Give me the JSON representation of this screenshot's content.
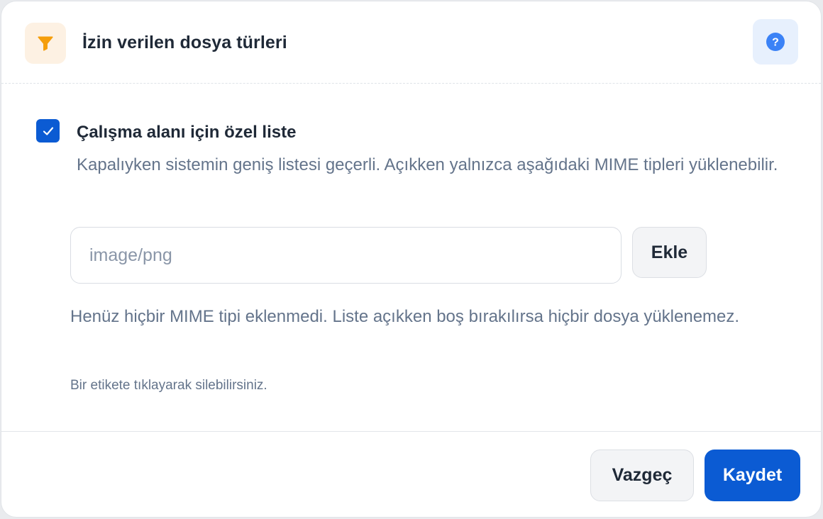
{
  "dialog": {
    "title": "İzin verilen dosya türleri",
    "title_icon": "filter-icon",
    "help_icon": "help-circle-icon"
  },
  "option": {
    "checked": true,
    "label": "Çalışma alanı için özel liste",
    "description": "Kapalıyken sistemin geniş listesi geçerli. Açıkken yalnızca aşağıdaki MIME tipleri yüklenebilir."
  },
  "mime_input": {
    "value": "",
    "placeholder": "image/png"
  },
  "add_button": {
    "label": "Ekle"
  },
  "empty_message": "Henüz hiçbir MIME tipi eklenmedi. Liste açıkken boş bırakılırsa hiçbir dosya yüklenemez.",
  "hint": "Bir etikete tıklayarak silebilirsiniz.",
  "footer": {
    "cancel_label": "Vazgeç",
    "save_label": "Kaydet"
  },
  "colors": {
    "primary": "#0b5bd3",
    "filter_accent": "#f59e0b",
    "help_accent": "#3b82f6"
  }
}
